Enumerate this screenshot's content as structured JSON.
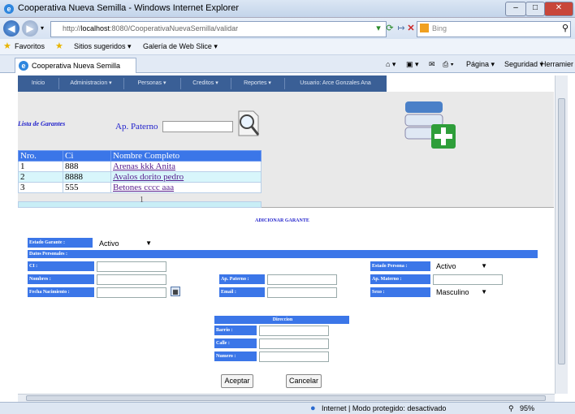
{
  "window": {
    "title": "Cooperativa Nueva Semilla - Windows Internet Explorer"
  },
  "address": {
    "prefix": "http://",
    "host": "localhost",
    "path": ":8080/CooperativaNuevaSemilla/validar"
  },
  "search": {
    "placeholder": "Bing"
  },
  "favorites": {
    "label": "Favoritos",
    "suggested": "Sitios sugeridos ▾",
    "gallery": "Galería de Web Slice ▾"
  },
  "tab": {
    "label": "Cooperativa Nueva Semilla"
  },
  "commandbar": {
    "page": "Página ▾",
    "security": "Seguridad ▾",
    "tools": "Herramientas ▾"
  },
  "menu": {
    "items": [
      {
        "label": "Inicio"
      },
      {
        "label": "Administracion ▾"
      },
      {
        "label": "Personas ▾"
      },
      {
        "label": "Creditos ▾"
      },
      {
        "label": "Reportes ▾"
      },
      {
        "label": "Usuario: Arce Gonzales Ana"
      }
    ]
  },
  "lista": {
    "title": "Lista de Garantes",
    "filter_label": "Ap. Paterno",
    "filter_value": ""
  },
  "grid": {
    "headers": [
      "Nro.",
      "Ci",
      "Nombre Completo"
    ],
    "rows": [
      [
        "1",
        "888",
        "Arenas kkk Anita"
      ],
      [
        "2",
        "8888",
        "Avalos dorito pedro"
      ],
      [
        "3",
        "555",
        "Betones cccc aaa"
      ]
    ],
    "pager": "1"
  },
  "form": {
    "title": "ADICIONAR GARANTE",
    "estado_garante_label": "Estado Garante :",
    "estado_garante_value": "Activo",
    "datos_personales": "Datos Personales :",
    "ci_label": "CI :",
    "nombres_label": "Nombres :",
    "fecha_label": "Fecha Nacimiento :",
    "ap_paterno_label": "Ap. Paterno :",
    "email_label": "Email :",
    "estado_persona_label": "Estado Persona :",
    "estado_persona_value": "Activo",
    "ap_materno_label": "Ap. Materno :",
    "sexo_label": "Sexo :",
    "sexo_value": "Masculino",
    "direccion_title": "Direccion",
    "barrio_label": "Barrio :",
    "calle_label": "Calle :",
    "numero_label": "Numero :",
    "aceptar": "Aceptar",
    "cancelar": "Cancelar"
  },
  "status": {
    "text": "Internet | Modo protegido: desactivado",
    "zoom": "95%"
  }
}
